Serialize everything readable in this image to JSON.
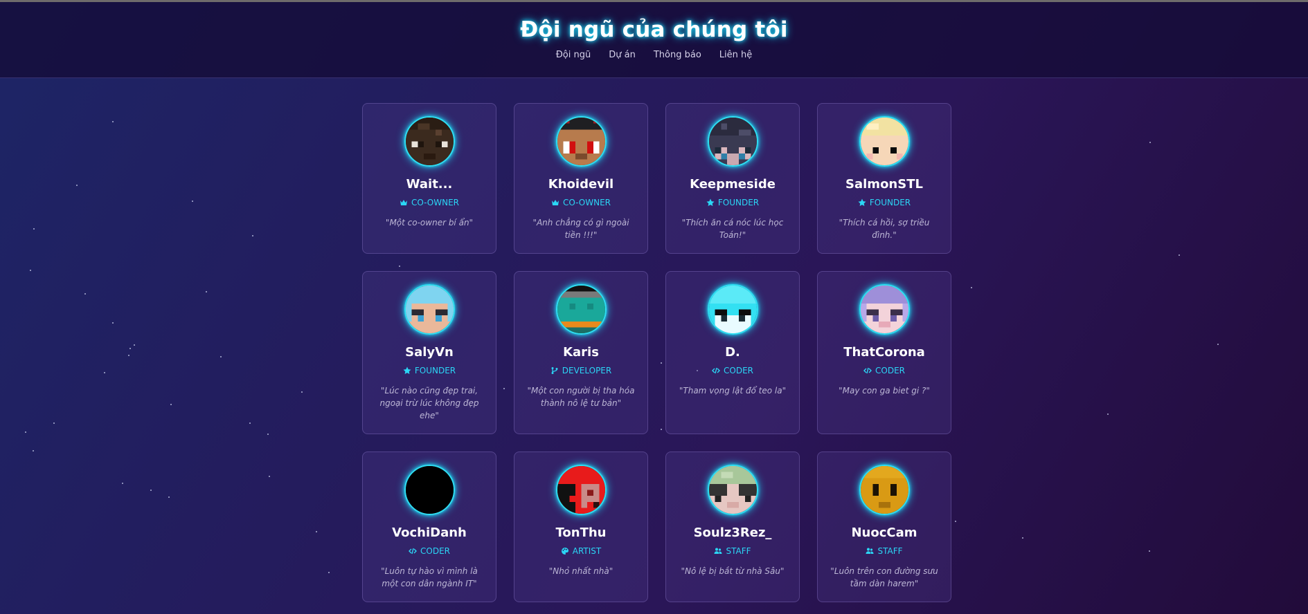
{
  "header": {
    "title": "Đội ngũ của chúng tôi",
    "nav": [
      "Đội ngũ",
      "Dự án",
      "Thông báo",
      "Liên hệ"
    ]
  },
  "accent_color": "#2bd6f5",
  "members": [
    {
      "name": "Wait...",
      "role": "CO-OWNER",
      "role_icon": "crown-icon",
      "quote": "\"Một co-owner bí ẩn\"",
      "avatar": "dark-brown-skin"
    },
    {
      "name": "Khoidevil",
      "role": "CO-OWNER",
      "role_icon": "crown-icon",
      "quote": "\"Anh chẳng có gì ngoài tiền !!!\"",
      "avatar": "red-eyed-devil"
    },
    {
      "name": "Keepmeside",
      "role": "FOUNDER",
      "role_icon": "star-icon",
      "quote": "\"Thích ăn cá nóc lúc học Toán!\"",
      "avatar": "dark-hair-blue-eyes"
    },
    {
      "name": "SalmonSTL",
      "role": "FOUNDER",
      "role_icon": "star-icon",
      "quote": "\"Thích cá hồi, sợ triều đình.\"",
      "avatar": "blonde-skin"
    },
    {
      "name": "SalyVn",
      "role": "FOUNDER",
      "role_icon": "star-icon",
      "quote": "\"Lúc nào cũng đẹp trai, ngoại trừ lúc không đẹp ehe\"",
      "avatar": "light-blue-hair"
    },
    {
      "name": "Karis",
      "role": "DEVELOPER",
      "role_icon": "branch-icon",
      "quote": "\"Một con người bị tha hóa thành nô lệ tư bản\"",
      "avatar": "teal-orange-skin"
    },
    {
      "name": "D.",
      "role": "CODER",
      "role_icon": "code-icon",
      "quote": "\"Tham vọng lật đổ teo la\"",
      "avatar": "cyan-skin"
    },
    {
      "name": "ThatCorona",
      "role": "CODER",
      "role_icon": "code-icon",
      "quote": "\"May con ga biet gi ?\"",
      "avatar": "purple-hair"
    },
    {
      "name": "VochiDanh",
      "role": "CODER",
      "role_icon": "code-icon",
      "quote": "\"Luôn tự hào vì mình là một con dân ngành IT\"",
      "avatar": "black-skin"
    },
    {
      "name": "TonThu",
      "role": "ARTIST",
      "role_icon": "palette-icon",
      "quote": "\"Nhỏ nhất nhà\"",
      "avatar": "red-black-skin"
    },
    {
      "name": "Soulz3Rez_",
      "role": "STAFF",
      "role_icon": "users-icon",
      "quote": "\"Nô lệ bị bắt từ nhà Sâu\"",
      "avatar": "green-hair-skin"
    },
    {
      "name": "NuocCam",
      "role": "STAFF",
      "role_icon": "users-icon",
      "quote": "\"Luôn trên con đường sưu tầm dàn harem\"",
      "avatar": "orange-face"
    }
  ]
}
